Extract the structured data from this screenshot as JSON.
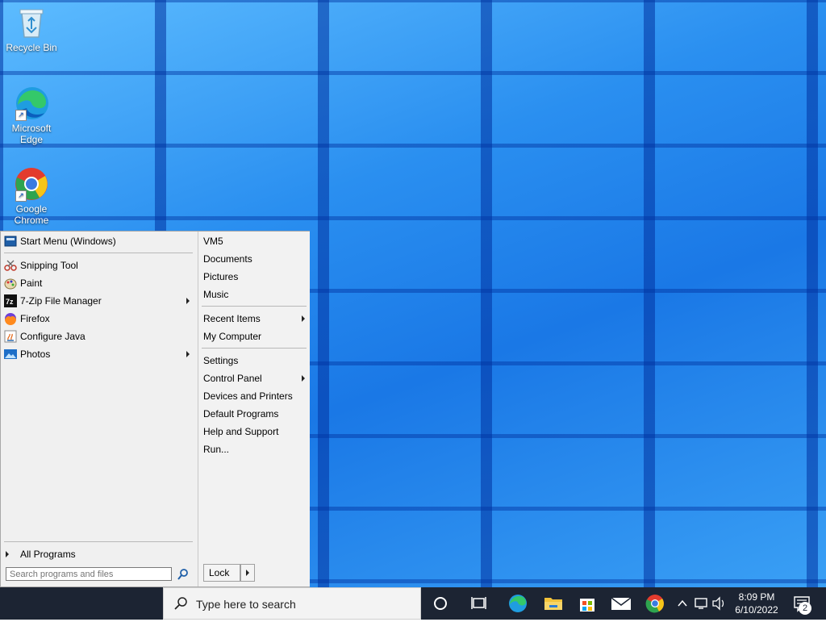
{
  "desktop": {
    "icons": [
      {
        "label": "Recycle Bin"
      },
      {
        "label": "Microsoft Edge"
      },
      {
        "label": "Google Chrome"
      }
    ]
  },
  "start_menu": {
    "header": "Start Menu (Windows)",
    "programs": [
      {
        "label": "Snipping Tool",
        "icon": "scissors-icon"
      },
      {
        "label": "Paint",
        "icon": "palette-icon"
      },
      {
        "label": "7-Zip File Manager",
        "icon": "7zip-icon",
        "submenu": true
      },
      {
        "label": "Firefox",
        "icon": "firefox-icon"
      },
      {
        "label": "Configure Java",
        "icon": "java-icon"
      },
      {
        "label": "Photos",
        "icon": "photos-icon",
        "submenu": true
      }
    ],
    "all_programs": "All Programs",
    "search_placeholder": "Search programs and files",
    "right": {
      "user": "VM5",
      "documents": "Documents",
      "pictures": "Pictures",
      "music": "Music",
      "recent_items": "Recent Items",
      "my_computer": "My Computer",
      "settings": "Settings",
      "control_panel": "Control Panel",
      "devices_printers": "Devices and Printers",
      "default_programs": "Default Programs",
      "help_support": "Help and Support",
      "run": "Run..."
    },
    "lock_label": "Lock"
  },
  "taskbar": {
    "search_text": "Type here to search",
    "time": "8:09 PM",
    "date": "6/10/2022",
    "notification_count": "2"
  }
}
